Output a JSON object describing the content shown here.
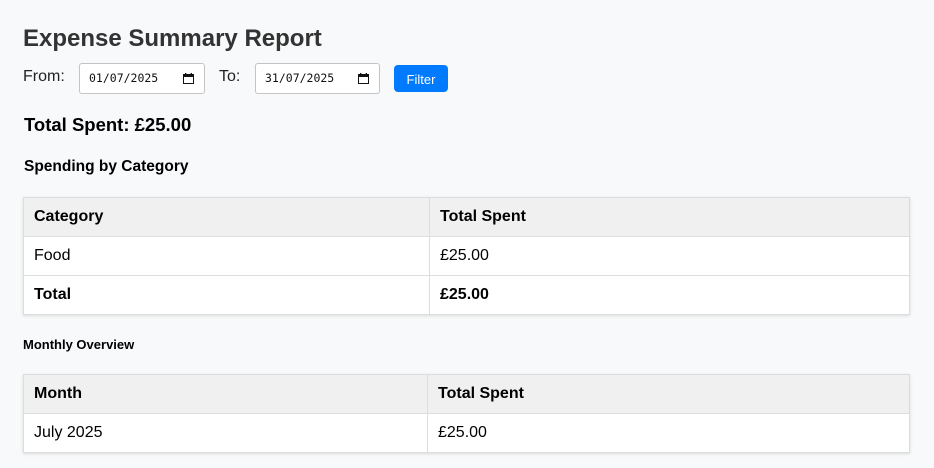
{
  "report": {
    "title": "Expense Summary Report",
    "from_label": "From:",
    "from_value": "01/07/2025",
    "to_label": "To:",
    "to_value": "31/07/2025",
    "filter_label": "Filter",
    "total_spent": "Total Spent: £25.00"
  },
  "category": {
    "heading": "Spending by Category",
    "headers": [
      "Category",
      "Total Spent"
    ],
    "rows": [
      [
        "Food",
        "£25.00"
      ]
    ],
    "total_row": [
      "Total",
      "£25.00"
    ]
  },
  "monthly": {
    "heading": "Monthly Overview",
    "headers": [
      "Month",
      "Total Spent"
    ],
    "rows": [
      [
        "July 2025",
        "£25.00"
      ]
    ]
  },
  "colors": {
    "accent": "#007bff",
    "header_bg": "#f0f0f0",
    "page_bg": "#f8f9fa",
    "title": "#333333"
  }
}
